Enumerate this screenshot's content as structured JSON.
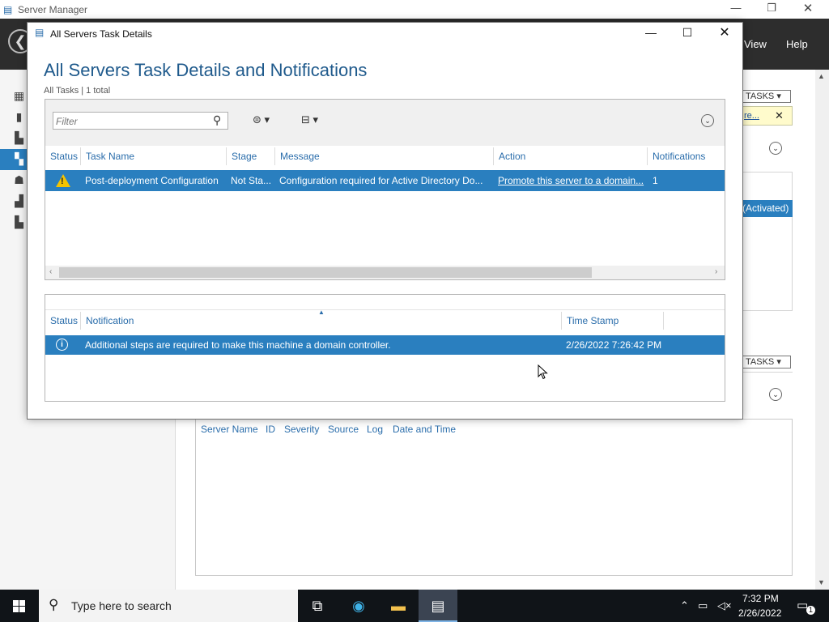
{
  "background_window": {
    "title": "Server Manager",
    "menu": [
      "View",
      "Help"
    ],
    "tasks_label_1": "TASKS",
    "yellow_link": "re...",
    "activated_text": "(Activated)",
    "tasks_label_2": "TASKS",
    "events_columns": [
      "Server Name",
      "ID",
      "Severity",
      "Source",
      "Log",
      "Date and Time"
    ]
  },
  "dialog": {
    "title": "All Servers Task Details",
    "heading": "All Servers Task Details and Notifications",
    "subtitle": "All Tasks | 1 total",
    "filter_placeholder": "Filter",
    "tasks_columns": {
      "status": "Status",
      "task_name": "Task Name",
      "stage": "Stage",
      "message": "Message",
      "action": "Action",
      "notifications": "Notifications"
    },
    "tasks_rows": [
      {
        "status_icon": "warning-icon",
        "task_name": "Post-deployment Configuration",
        "stage": "Not Sta...",
        "message": "Configuration required for Active Directory Do...",
        "action": "Promote this server to a domain...",
        "notifications": "1"
      }
    ],
    "notif_columns": {
      "status": "Status",
      "notification": "Notification",
      "time_stamp": "Time Stamp"
    },
    "notif_rows": [
      {
        "status_icon": "info-icon",
        "notification": "Additional steps are required to make this machine a domain controller.",
        "time_stamp": "2/26/2022 7:26:42 PM"
      }
    ]
  },
  "taskbar": {
    "search_placeholder": "Type here to search",
    "time": "7:32 PM",
    "date": "2/26/2022",
    "notification_count": "1"
  },
  "colors": {
    "selection": "#2a7fbf",
    "heading": "#1f5a8c",
    "header_bg": "#2d2d2d",
    "taskbar_bg": "#101418"
  }
}
